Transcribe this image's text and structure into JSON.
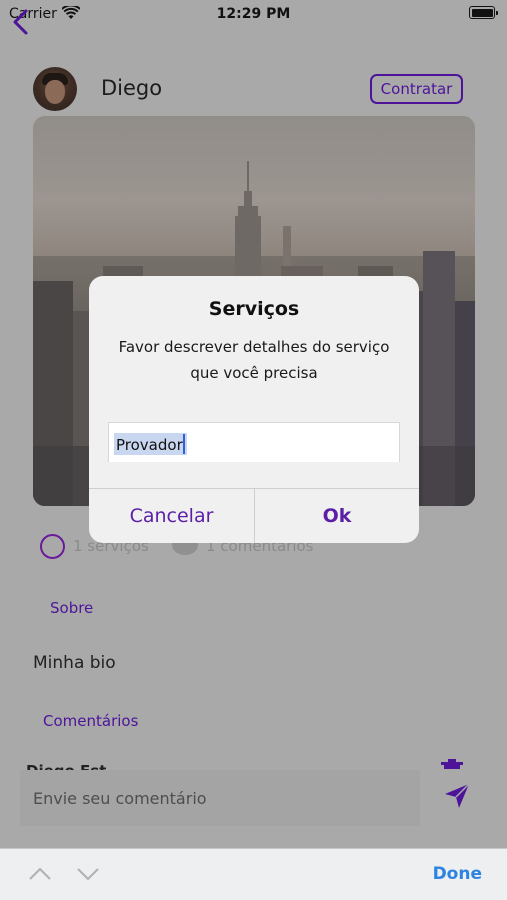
{
  "status_bar": {
    "carrier": "Carrier",
    "time": "12:29 PM"
  },
  "profile": {
    "name": "Diego",
    "hire_label": "Contratar"
  },
  "stats": {
    "services": "1 serviços",
    "comments": "1 comentários"
  },
  "about": {
    "section_label": "Sobre",
    "bio": "Minha bio"
  },
  "comments": {
    "section_label": "Comentários",
    "first_author_peek": "Diego Est",
    "input_placeholder": "Envie seu comentário"
  },
  "dialog": {
    "title": "Serviços",
    "message": "Favor descrever detalhes do serviço que você precisa",
    "field_value": "Provador",
    "cancel_label": "Cancelar",
    "ok_label": "Ok"
  },
  "keyboard_toolbar": {
    "done_label": "Done"
  },
  "colors": {
    "accent": "#4d149a",
    "done_blue": "#2d84e0",
    "overlay": "#a9a9a9"
  },
  "icons": [
    "wifi-icon",
    "battery-icon",
    "back-chevron-icon",
    "check-circle-icon",
    "chat-bubble-icon",
    "trash-icon",
    "send-icon",
    "chevron-up-icon",
    "chevron-down-icon"
  ]
}
